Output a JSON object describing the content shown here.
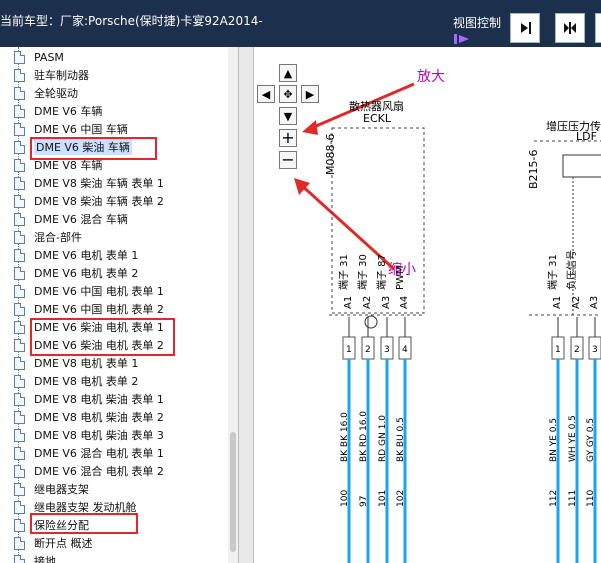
{
  "header": {
    "title": "当前车型：厂家:Porsche(保时捷)卡宴92A2014-",
    "view_label": "视图控制"
  },
  "sidebar": {
    "items": [
      {
        "label": "PASM"
      },
      {
        "label": "驻车制动器"
      },
      {
        "label": "全轮驱动"
      },
      {
        "label": "DME V6 车辆"
      },
      {
        "label": "DME V6 中国 车辆"
      },
      {
        "label": "DME V6 柴油 车辆"
      },
      {
        "label": "DME V8 车辆"
      },
      {
        "label": "DME V8 柴油 车辆 表单 1"
      },
      {
        "label": "DME V8 柴油 车辆 表单 2"
      },
      {
        "label": "DME V6 混合 车辆"
      },
      {
        "label": "混合-部件"
      },
      {
        "label": "DME V6 电机 表单 1"
      },
      {
        "label": "DME V6 电机 表单 2"
      },
      {
        "label": "DME V6 中国 电机 表单 1"
      },
      {
        "label": "DME V6 中国 电机 表单 2"
      },
      {
        "label": "DME V6 柴油 电机 表单 1"
      },
      {
        "label": "DME V6 柴油 电机 表单 2"
      },
      {
        "label": "DME V8 电机 表单 1"
      },
      {
        "label": "DME V8 电机 表单 2"
      },
      {
        "label": "DME V8 电机 柴油 表单 1"
      },
      {
        "label": "DME V8 电机 柴油 表单 2"
      },
      {
        "label": "DME V8 电机 柴油 表单 3"
      },
      {
        "label": "DME V6 混合 电机 表单 1"
      },
      {
        "label": "DME V6 混合 电机 表单 2"
      },
      {
        "label": "继电器支架"
      },
      {
        "label": "继电器支架 发动机舱"
      },
      {
        "label": "保险丝分配"
      },
      {
        "label": "断开点 概述"
      },
      {
        "label": "接地"
      }
    ]
  },
  "annotations": {
    "zoom_in": "放大",
    "zoom_out": "缩小"
  },
  "diagram": {
    "component1_name": "散热器风扇",
    "component1_code": "ECKL",
    "component1_id": "M088-6",
    "component2_name": "增压压力传",
    "component2_code": "LDF",
    "component2_id": "B215-6",
    "pins_left": [
      "端子 31",
      "端子 30",
      "端子 87",
      "PWM"
    ],
    "pins_left_ids": [
      "A1",
      "A2",
      "A3",
      "A4"
    ],
    "pins_right": [
      "端子 31",
      "负压信号"
    ],
    "pins_right_ids": [
      "A1",
      "A2",
      "A3"
    ],
    "connectors_left": [
      "1",
      "2",
      "3",
      "4"
    ],
    "connectors_right": [
      "1",
      "2",
      "3"
    ],
    "wires_left": [
      "BK BK 16.0",
      "BK RD 16.0",
      "RD GN 1.0",
      "BK BU 0.5"
    ],
    "wire_nums_left": [
      "100",
      "97",
      "101",
      "102"
    ],
    "wires_right": [
      "BN YE 0.5",
      "WH YE 0.5",
      "GY GY 0.5"
    ],
    "wire_nums_right": [
      "112",
      "111",
      "110"
    ]
  }
}
